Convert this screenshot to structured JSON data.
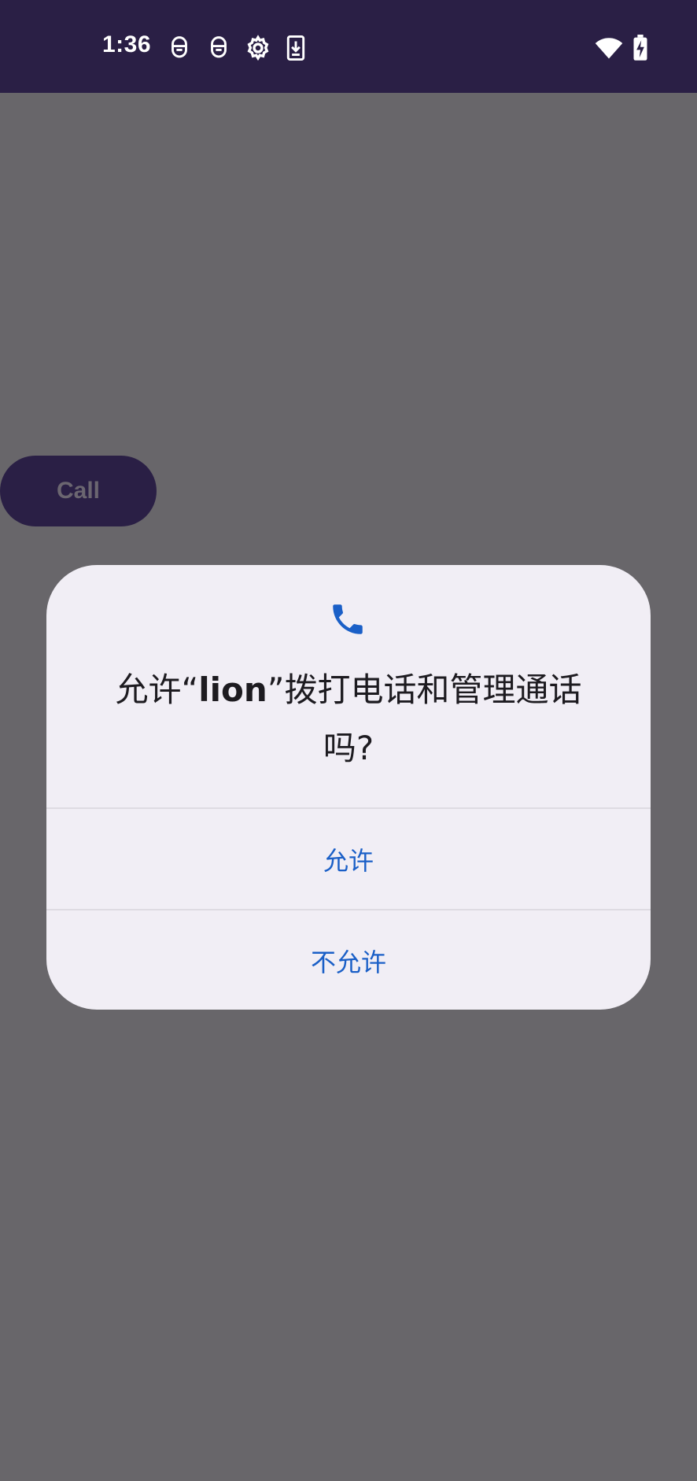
{
  "status_bar": {
    "time": "1:36",
    "left_icons": [
      "notification-robot-icon",
      "notification-robot-icon",
      "settings-gear-icon",
      "download-icon"
    ],
    "right_icons": [
      "wifi-icon",
      "battery-charging-icon"
    ],
    "background": "#2a1f45"
  },
  "app": {
    "call_button_label": "Call"
  },
  "dialog": {
    "icon": "phone-icon",
    "icon_color": "#1a5fc7",
    "title_prefix": "允许“",
    "app_name": "lion",
    "title_suffix": "”拨打电话和管理通话吗?",
    "allow_label": "允许",
    "deny_label": "不允许",
    "accent_color": "#1a5fc7"
  }
}
